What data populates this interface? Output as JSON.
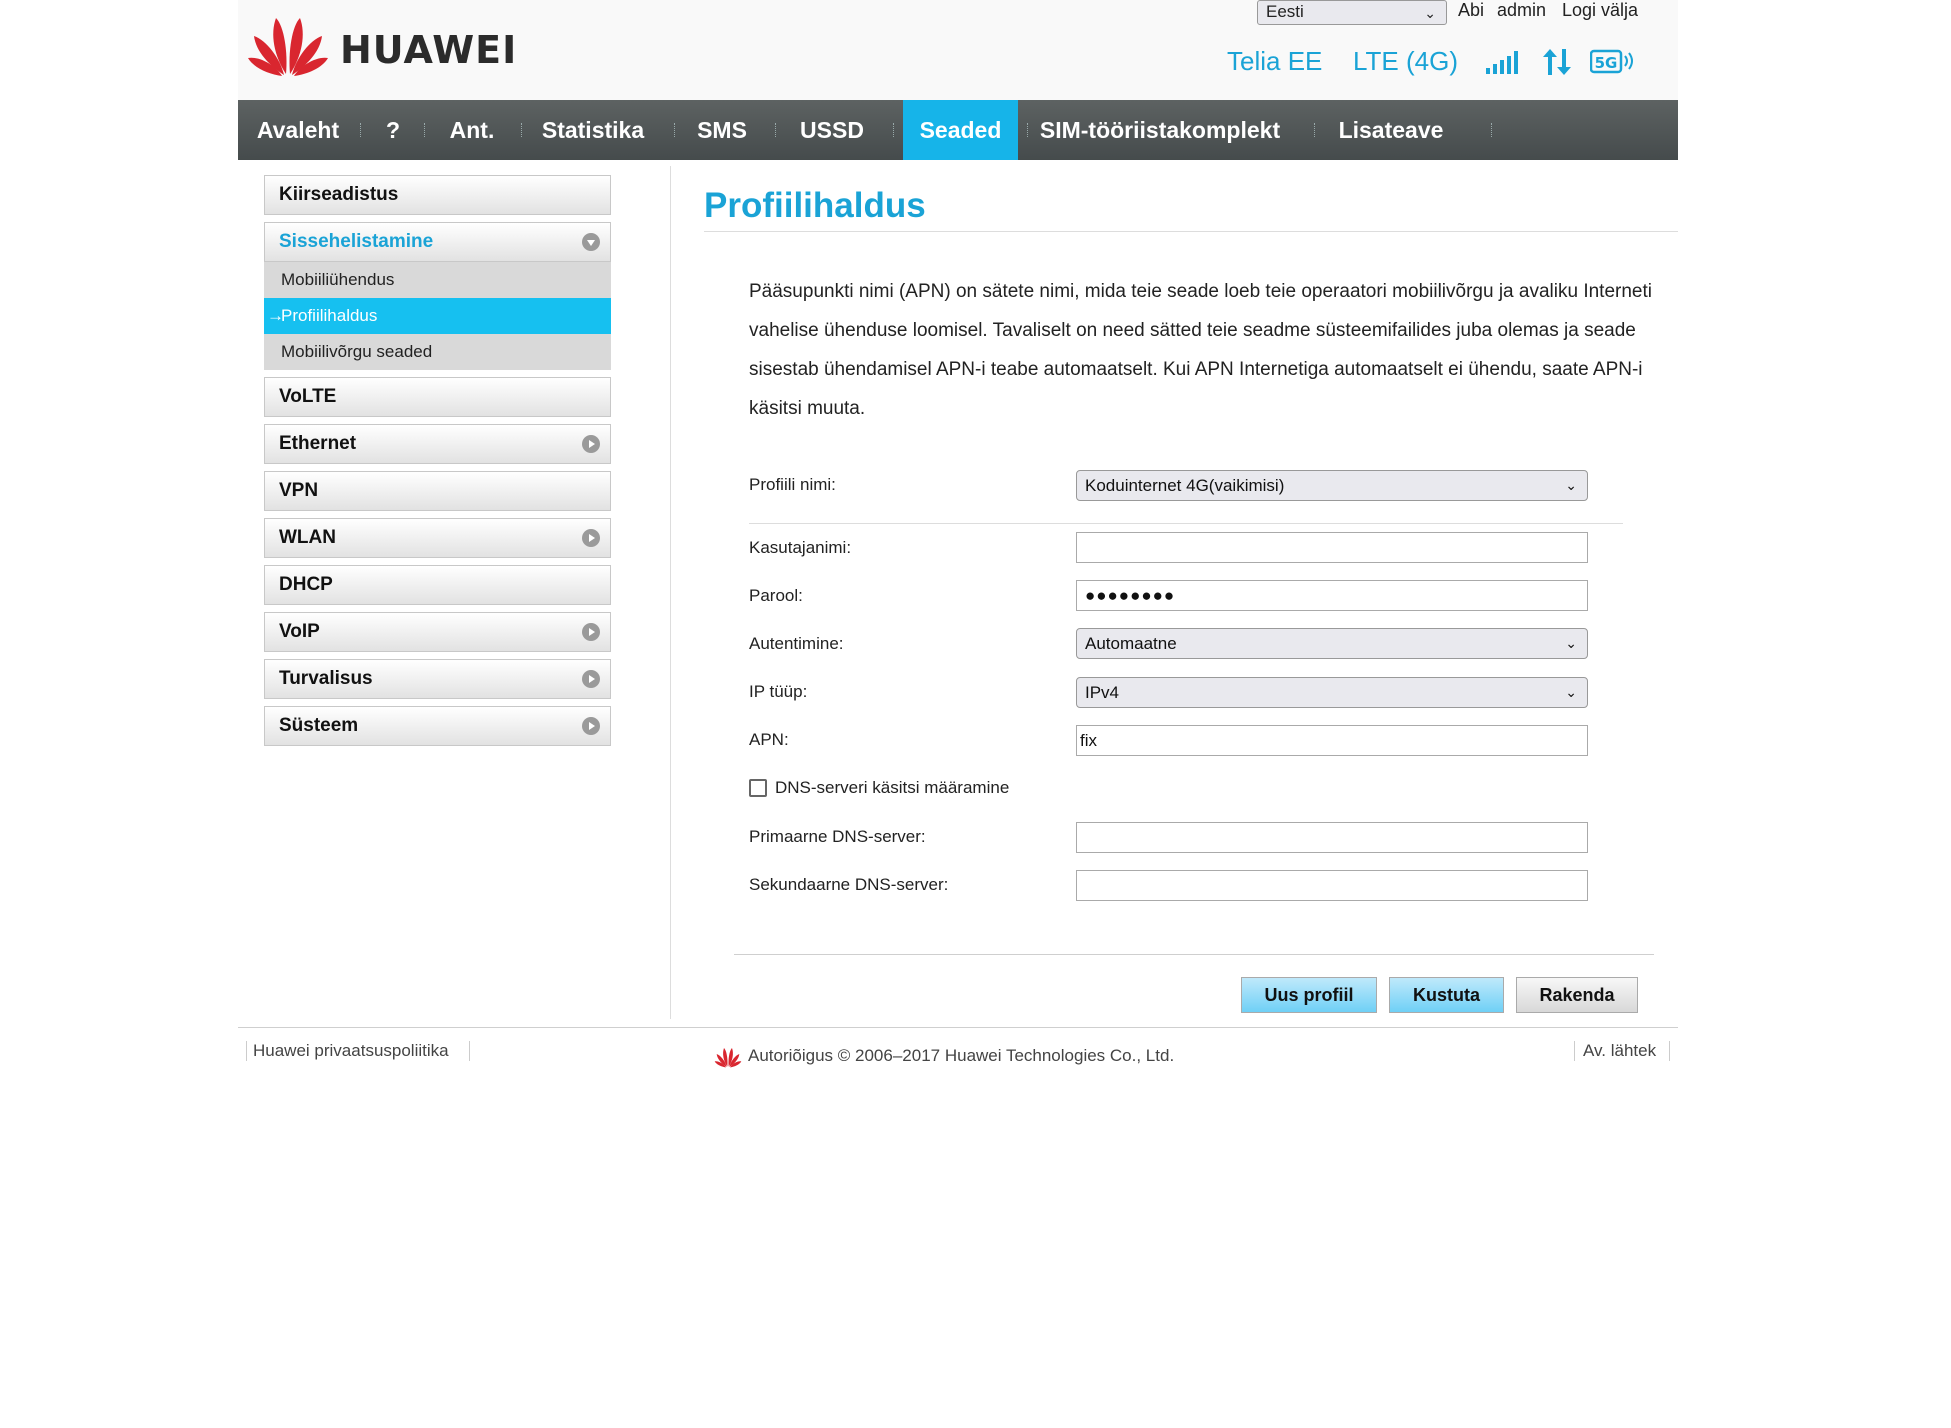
{
  "brand": {
    "name": "HUAWEI"
  },
  "header": {
    "language": "Eesti",
    "help": "Abi",
    "user": "admin",
    "logout": "Logi välja",
    "operator": "Telia EE",
    "network_type": "LTE (4G)",
    "accent_color": "#1aa3d6"
  },
  "nav": {
    "items": [
      "Avaleht",
      "?",
      "Ant.",
      "Statistika",
      "SMS",
      "USSD",
      "Seaded",
      "SIM-tööriistakomplekt",
      "Lisateave"
    ],
    "active": "Seaded"
  },
  "sidebar": {
    "quick_setup": "Kiirseadistus",
    "dialup": "Sissehelistamine",
    "dialup_sub": [
      "Mobiiliühendus",
      "Profiilihaldus",
      "Mobiilivõrgu seaded"
    ],
    "active_sub": "Profiilihaldus",
    "items": [
      "VoLTE",
      "Ethernet",
      "VPN",
      "WLAN",
      "DHCP",
      "VoIP",
      "Turvalisus",
      "Süsteem"
    ]
  },
  "main": {
    "title": "Profiilihaldus",
    "description": "Pääsupunkti nimi (APN) on sätete nimi, mida teie seade loeb teie operaatori mobiilivõrgu ja avaliku Interneti vahelise ühenduse loomisel. Tavaliselt on need sätted teie seadme süsteemifailides juba olemas ja seade sisestab ühendamisel APN-i teabe automaatselt. Kui APN Internetiga automaatselt ei ühendu, saate APN-i käsitsi muuta.",
    "form": {
      "profile_label": "Profiili nimi:",
      "profile_value": "Koduinternet 4G(vaikimisi)",
      "username_label": "Kasutajanimi:",
      "username_value": "",
      "password_label": "Parool:",
      "password_value": "●●●●●●●●",
      "auth_label": "Autentimine:",
      "auth_value": "Automaatne",
      "iptype_label": "IP tüüp:",
      "iptype_value": "IPv4",
      "apn_label": "APN:",
      "apn_value": "fix",
      "dns_manual_label": "DNS-serveri käsitsi määramine",
      "primary_dns_label": "Primaarne DNS-server:",
      "secondary_dns_label": "Sekundaarne DNS-server:"
    },
    "buttons": {
      "new_profile": "Uus profiil",
      "delete": "Kustuta",
      "apply": "Rakenda"
    }
  },
  "footer": {
    "privacy": "Huawei privaatsuspoliitika",
    "copyright": "Autoriõigus © 2006–2017 Huawei Technologies Co., Ltd.",
    "open_source": "Av. lähtek"
  }
}
